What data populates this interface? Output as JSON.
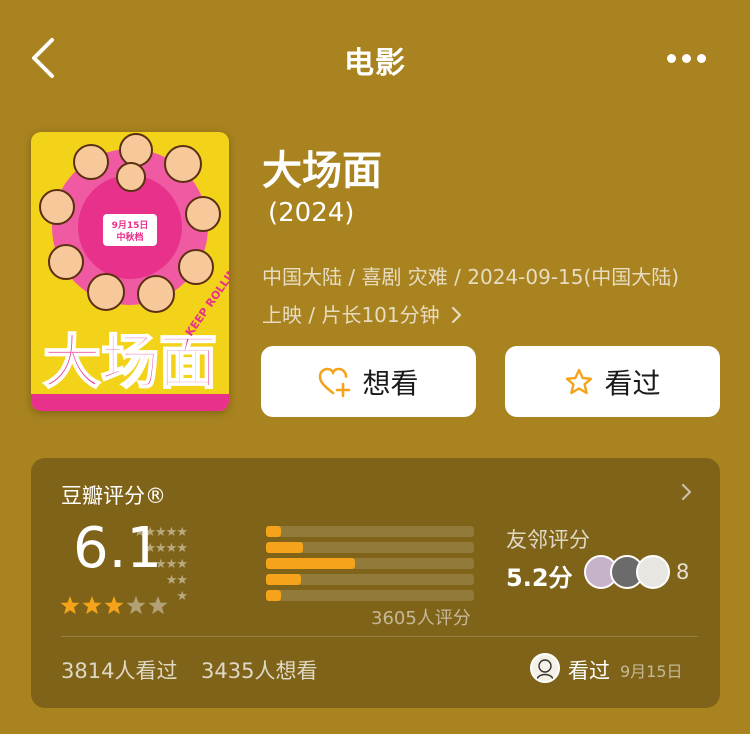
{
  "header": {
    "title": "电影"
  },
  "movie": {
    "title": "大场面",
    "year": "(2024)",
    "meta_line1": "中国大陆 / 喜剧 灾难 / 2024-09-15(中国大陆)",
    "meta_line2": "上映 / 片长101分钟",
    "poster": {
      "title_text": "大场面",
      "sub_text": "KEEP ROLLING",
      "date_badge": "9月15日 中秋档",
      "colors": {
        "bg": "#f3d21a",
        "pink": "#e8318a",
        "ring": "#ef5aa2"
      }
    }
  },
  "actions": {
    "want_label": "想看",
    "seen_label": "看过"
  },
  "rating": {
    "label": "豆瓣评分®",
    "score": "6.1",
    "stars": 3,
    "distribution_percent": [
      7,
      18,
      43,
      17,
      7
    ],
    "count_text": "3605人评分",
    "friend_label": "友邻评分",
    "friend_score": "5.2分",
    "friend_count": "8",
    "seen_text": "3814人看过",
    "want_text": "3435人想看",
    "my_status": "看过",
    "my_date": "9月15日"
  },
  "colors": {
    "background": "#a8831f",
    "accent": "#f5a31a"
  }
}
